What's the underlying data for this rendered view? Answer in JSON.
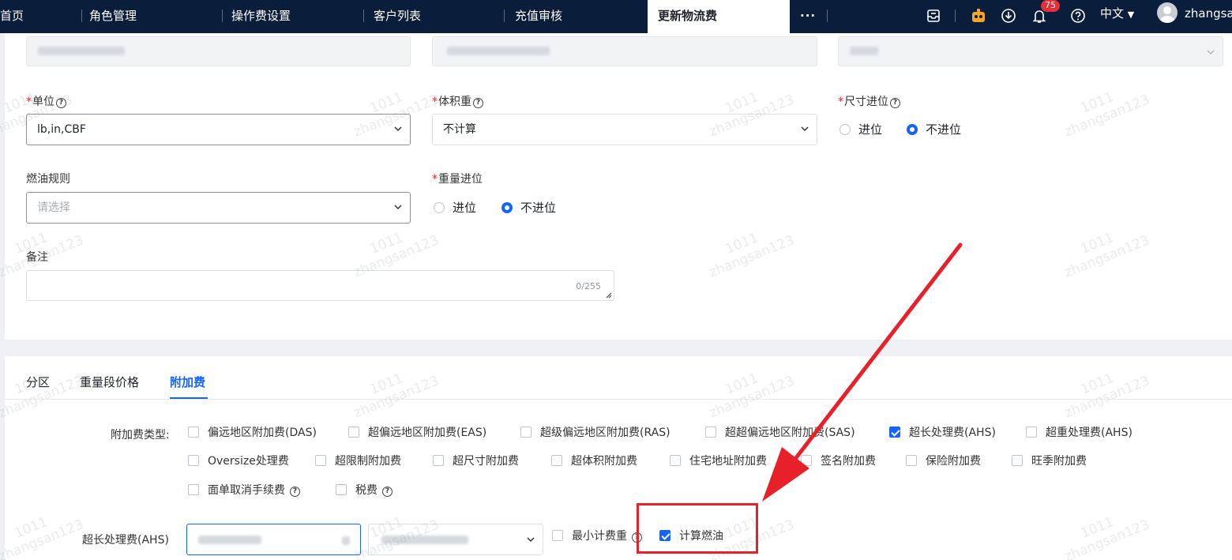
{
  "nav": {
    "tabs": [
      "首页",
      "角色管理",
      "操作费设置",
      "客户列表",
      "充值审核"
    ],
    "active_tab": "更新物流费",
    "more": "···",
    "notification_count": "75",
    "language": "中文",
    "username": "zhangsan"
  },
  "form": {
    "unit": {
      "label": "单位",
      "value": "lb,in,CBF"
    },
    "volume_weight": {
      "label": "体积重",
      "value": "不计算"
    },
    "size_rounding": {
      "label": "尺寸进位",
      "options": [
        "进位",
        "不进位"
      ],
      "selected": "不进位"
    },
    "fuel_rule": {
      "label": "燃油规则",
      "placeholder": "请选择"
    },
    "weight_rounding": {
      "label": "重量进位",
      "options": [
        "进位",
        "不进位"
      ],
      "selected": "不进位"
    },
    "remark": {
      "label": "备注",
      "counter": "0/255"
    }
  },
  "tabs": {
    "items": [
      "分区",
      "重量段价格",
      "附加费"
    ],
    "active": "附加费"
  },
  "surcharge": {
    "type_label": "附加费类型:",
    "options": [
      {
        "label": "偏远地区附加费(DAS)",
        "checked": false
      },
      {
        "label": "超偏远地区附加费(EAS)",
        "checked": false
      },
      {
        "label": "超级偏远地区附加费(RAS)",
        "checked": false
      },
      {
        "label": "超超偏远地区附加费(SAS)",
        "checked": false
      },
      {
        "label": "超长处理费(AHS)",
        "checked": true
      },
      {
        "label": "超重处理费(AHS)",
        "checked": false
      },
      {
        "label": "Oversize处理费",
        "checked": false
      },
      {
        "label": "超限制附加费",
        "checked": false
      },
      {
        "label": "超尺寸附加费",
        "checked": false
      },
      {
        "label": "超体积附加费",
        "checked": false
      },
      {
        "label": "住宅地址附加费",
        "checked": false
      },
      {
        "label": "签名附加费",
        "checked": false
      },
      {
        "label": "保险附加费",
        "checked": false
      },
      {
        "label": "旺季附加费",
        "checked": false
      },
      {
        "label": "面单取消手续费",
        "checked": false
      },
      {
        "label": "税费",
        "checked": false
      }
    ],
    "ahs_row": {
      "label": "超长处理费(AHS)",
      "min_weight_label": "最小计费重",
      "fuel_label": "计算燃油",
      "fuel_checked": true
    }
  },
  "watermark": {
    "line1": "1011",
    "line2": "zhangsan123"
  },
  "colors": {
    "nav_bg": "#0a1d3a",
    "primary": "#1664ff",
    "required": "#f5222d",
    "annotation": "#e8202a"
  }
}
